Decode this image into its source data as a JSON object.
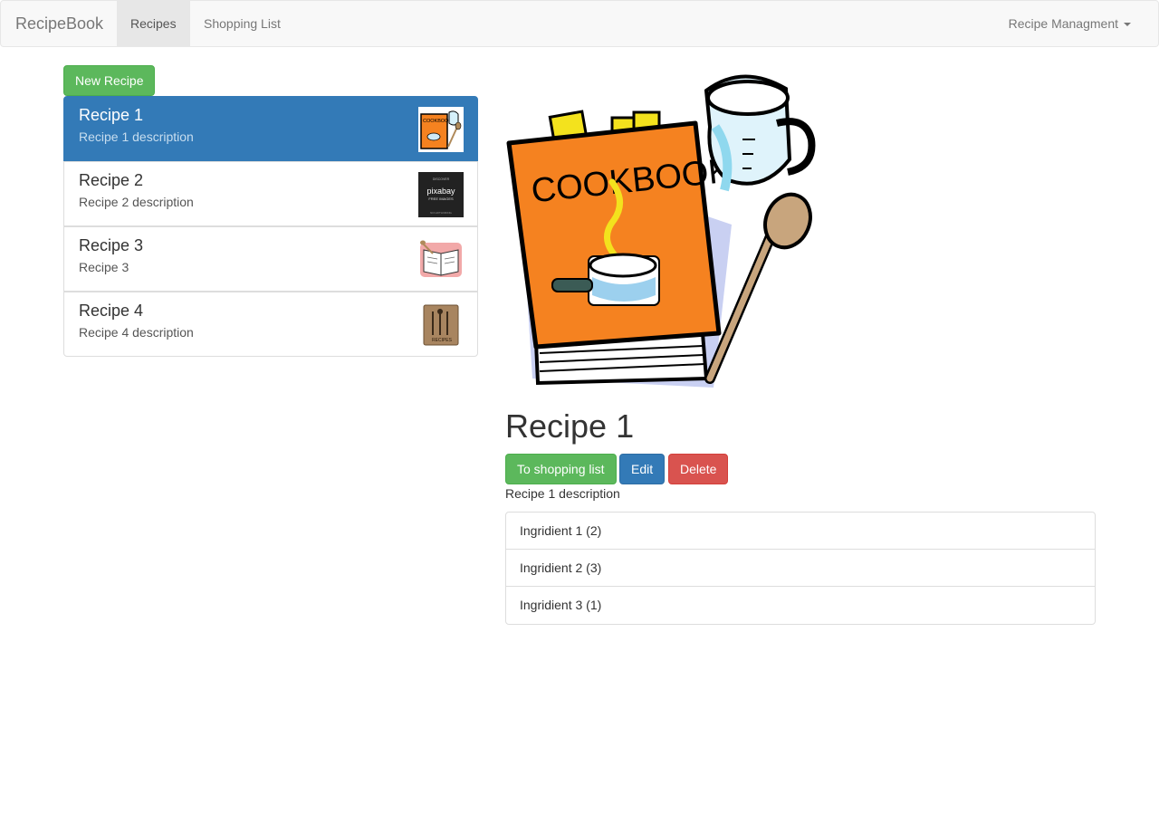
{
  "navbar": {
    "brand": "RecipeBook",
    "tabs": [
      {
        "label": "Recipes",
        "active": true
      },
      {
        "label": "Shopping List",
        "active": false
      }
    ],
    "dropdown_label": "Recipe Managment"
  },
  "sidebar": {
    "new_button": "New Recipe",
    "recipes": [
      {
        "name": "Recipe 1",
        "description": "Recipe 1 description",
        "active": true,
        "thumb": "cookbook-icon"
      },
      {
        "name": "Recipe 2",
        "description": "Recipe 2 description",
        "active": false,
        "thumb": "pixabay-logo"
      },
      {
        "name": "Recipe 3",
        "description": "Recipe 3",
        "active": false,
        "thumb": "open-recipe-book-icon"
      },
      {
        "name": "Recipe 4",
        "description": "Recipe 4 description",
        "active": false,
        "thumb": "recipes-binder-icon"
      }
    ],
    "thumb_texts": {
      "pixabay_top": "DISCOVER",
      "pixabay_brand": "pixabay",
      "pixabay_sub": "FREE IMAGES",
      "pixabay_bottom": "NO HOTLINKING",
      "binder": "RECIPES",
      "cookbook": "COOKBOOK"
    }
  },
  "detail": {
    "image_title": "COOKBOOK",
    "title": "Recipe 1",
    "buttons": {
      "shopping": "To shopping list",
      "edit": "Edit",
      "delete": "Delete"
    },
    "description": "Recipe 1 description",
    "ingredients": [
      {
        "label": "Ingridient 1 (2)"
      },
      {
        "label": "Ingridient 2 (3)"
      },
      {
        "label": "Ingridient 3 (1)"
      }
    ]
  },
  "colors": {
    "success": "#5cb85c",
    "primary": "#337ab7",
    "danger": "#d9534f",
    "cookbook_orange": "#f58220"
  }
}
